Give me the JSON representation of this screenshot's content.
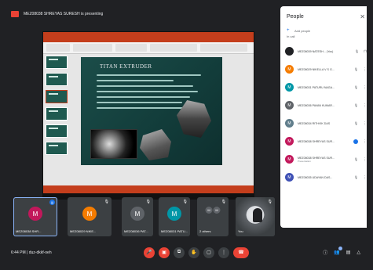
{
  "banner": {
    "text": "MEZ08038 SHREYAS SURESH is presenting"
  },
  "slide": {
    "title": "TITAN EXTRUDER"
  },
  "people_panel": {
    "title": "People",
    "add_people": "Add people",
    "in_call": "In call",
    "participants": [
      {
        "initial": "",
        "name": "MEZ08039 NATESH... (You)",
        "sub": "",
        "color": "#202124"
      },
      {
        "initial": "M",
        "name": "MEZ08029 NIKELLA V S G...",
        "sub": "",
        "color": "#f57c00"
      },
      {
        "initial": "M",
        "name": "MEZ08031 PATURU NAGA...",
        "sub": "",
        "color": "#0097a7"
      },
      {
        "initial": "M",
        "name": "MEZ08036 PAVAN KUMAR...",
        "sub": "",
        "color": "#5f6368"
      },
      {
        "initial": "M",
        "name": "MEZ08034 RITHVIK DAS",
        "sub": "",
        "color": "#607d8b"
      },
      {
        "initial": "M",
        "name": "MEZ08038 SHREYAS SUR...",
        "sub": "",
        "color": "#c2185b"
      },
      {
        "initial": "M",
        "name": "MEZ08038 SHREYAS SUR...",
        "sub": "Presentation",
        "color": "#c2185b"
      },
      {
        "initial": "M",
        "name": "MEZ08035 UDAYAN DAS...",
        "sub": "",
        "color": "#3f51b5"
      }
    ]
  },
  "tiles": [
    {
      "initial": "M",
      "name": "MEZ08038 SHR...",
      "color": "#c2185b"
    },
    {
      "initial": "M",
      "name": "MEZ08029 NIKE...",
      "color": "#f57c00"
    },
    {
      "initial": "M",
      "name": "MEZ08036 PAT...",
      "color": "#5f6368"
    },
    {
      "initial": "M",
      "name": "MEZ08031 PATU...",
      "color": "#0097a7"
    },
    {
      "initial": "",
      "name": "2 others",
      "color": "#5f6368"
    },
    {
      "initial": "",
      "name": "You",
      "color": ""
    }
  ],
  "bottom": {
    "time": "6:44 PM",
    "meeting_code": "duz-dkkf-oeh"
  },
  "colors": {
    "bg": "#202124",
    "accent_red": "#ea4335",
    "accent_blue": "#1a73e8"
  }
}
